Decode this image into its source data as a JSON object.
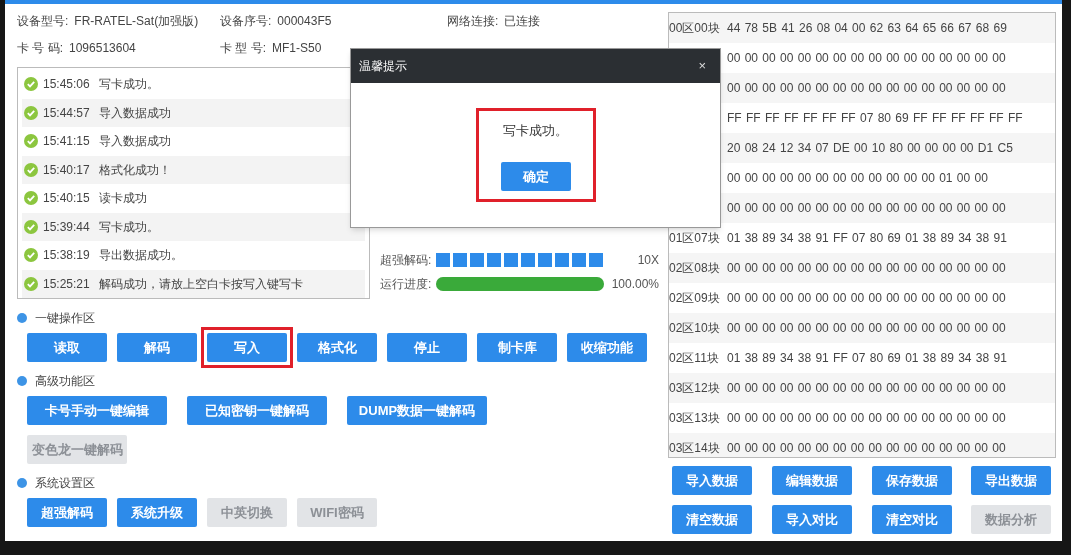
{
  "device_info": [
    {
      "label": "设备型号:",
      "value": "FR-RATEL-Sat(加强版)"
    },
    {
      "label": "设备序号:",
      "value": "000043F5"
    },
    {
      "label": "网络连接:",
      "value": "已连接"
    },
    {
      "label": "卡 号 码:",
      "value": "1096513604"
    },
    {
      "label": "卡 型 号:",
      "value": "MF1-S50"
    }
  ],
  "log": [
    {
      "time": "15:45:06",
      "message": "写卡成功。"
    },
    {
      "time": "15:44:57",
      "message": "导入数据成功"
    },
    {
      "time": "15:41:15",
      "message": "导入数据成功"
    },
    {
      "time": "15:40:17",
      "message": "格式化成功！"
    },
    {
      "time": "15:40:15",
      "message": "读卡成功"
    },
    {
      "time": "15:39:44",
      "message": "写卡成功。"
    },
    {
      "time": "15:38:19",
      "message": "导出数据成功。"
    },
    {
      "time": "15:25:21",
      "message": "解码成功，请放上空白卡按写入键写卡"
    }
  ],
  "progress": [
    {
      "kind": "segments",
      "label": "超强解码:",
      "level": 1,
      "reading": "10X"
    },
    {
      "kind": "bar",
      "label": "运行进度:",
      "level": 1,
      "reading": "100.00%"
    }
  ],
  "sections": [
    {
      "title": "一键操作区",
      "buttons": [
        {
          "label": "读取",
          "disabled": false,
          "highlighted": false
        },
        {
          "label": "解码",
          "disabled": false,
          "highlighted": false
        },
        {
          "label": "写入",
          "disabled": false,
          "highlighted": true
        },
        {
          "label": "格式化",
          "disabled": false,
          "highlighted": false
        },
        {
          "label": "停止",
          "disabled": false,
          "highlighted": false
        },
        {
          "label": "制卡库",
          "disabled": false,
          "highlighted": false
        },
        {
          "label": "收缩功能",
          "disabled": false,
          "highlighted": false
        }
      ]
    },
    {
      "title": "高级功能区",
      "buttons": [
        {
          "label": "卡号手动一键编辑",
          "disabled": false,
          "highlighted": false
        },
        {
          "label": "已知密钥一键解码",
          "disabled": false,
          "highlighted": false
        },
        {
          "label": "DUMP数据一键解码",
          "disabled": false,
          "highlighted": false
        },
        {
          "label": "变色龙一键解码",
          "disabled": true,
          "highlighted": false
        }
      ]
    },
    {
      "title": "系统设置区",
      "buttons": [
        {
          "label": "超强解码",
          "disabled": false,
          "highlighted": false
        },
        {
          "label": "系统升级",
          "disabled": false,
          "highlighted": false
        },
        {
          "label": "中英切换",
          "disabled": true,
          "highlighted": false
        },
        {
          "label": "WIFI密码",
          "disabled": true,
          "highlighted": false
        }
      ]
    }
  ],
  "hex_rows": [
    {
      "block": "00区00块",
      "bytes": "44 78 5B 41 26 08 04 00 62 63 64 65 66 67 68 69"
    },
    {
      "bytes": "00 00 00 00 00 00 00 00 00 00 00 00 00 00 00 00"
    },
    {
      "bytes": "00 00 00 00 00 00 00 00 00 00 00 00 00 00 00 00"
    },
    {
      "bytes": "FF FF FF FF FF FF FF 07 80 69 FF FF FF FF FF FF"
    },
    {
      "bytes": "20 08 24 12 34 07 DE 00 10 80 00 00 00 00 D1 C5"
    },
    {
      "bytes": "00 00 00 00 00 00 00 00 00 00 00 00 01 00 00"
    },
    {
      "bytes": "00 00 00 00 00 00 00 00 00 00 00 00 00 00 00 00"
    },
    {
      "block": "01区07块",
      "bytes": "01 38 89 34 38 91 FF 07 80 69 01 38 89 34 38 91"
    },
    {
      "block": "02区08块",
      "bytes": "00 00 00 00 00 00 00 00 00 00 00 00 00 00 00 00"
    },
    {
      "block": "02区09块",
      "bytes": "00 00 00 00 00 00 00 00 00 00 00 00 00 00 00 00"
    },
    {
      "block": "02区10块",
      "bytes": "00 00 00 00 00 00 00 00 00 00 00 00 00 00 00 00"
    },
    {
      "block": "02区11块",
      "bytes": "01 38 89 34 38 91 FF 07 80 69 01 38 89 34 38 91"
    },
    {
      "block": "03区12块",
      "bytes": "00 00 00 00 00 00 00 00 00 00 00 00 00 00 00 00"
    },
    {
      "block": "03区13块",
      "bytes": "00 00 00 00 00 00 00 00 00 00 00 00 00 00 00 00"
    },
    {
      "block": "03区14块",
      "bytes": "00 00 00 00 00 00 00 00 00 00 00 00 00 00 00 00"
    }
  ],
  "data_buttons": [
    {
      "label": "导入数据",
      "disabled": false
    },
    {
      "label": "编辑数据",
      "disabled": false
    },
    {
      "label": "保存数据",
      "disabled": false
    },
    {
      "label": "导出数据",
      "disabled": false
    },
    {
      "label": "清空数据",
      "disabled": false
    },
    {
      "label": "导入对比",
      "disabled": false
    },
    {
      "label": "清空对比",
      "disabled": false
    },
    {
      "label": "数据分析",
      "disabled": true
    }
  ],
  "dialog": {
    "title": "温馨提示",
    "close": "×",
    "message": "写卡成功。",
    "button": "确定",
    "highlighted": true
  }
}
